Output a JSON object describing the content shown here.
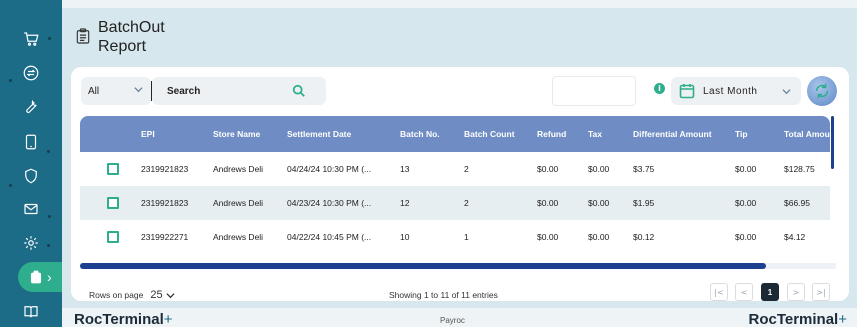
{
  "page": {
    "title_line1": "BatchOut",
    "title_line2": "Report"
  },
  "filters": {
    "scope_value": "All",
    "search_label": "Search",
    "date_range_value": "Last Month"
  },
  "table": {
    "columns": [
      "EPI",
      "Store Name",
      "Settlement Date",
      "Batch No.",
      "Batch Count",
      "Refund",
      "Tax",
      "Differential Amount",
      "Tip",
      "Total Amou"
    ],
    "rows": [
      [
        "2319921823",
        "Andrews Deli",
        "04/24/24 10:30 PM (...",
        "13",
        "2",
        "$0.00",
        "$0.00",
        "$3.75",
        "$0.00",
        "$128.75"
      ],
      [
        "2319921823",
        "Andrews Deli",
        "04/23/24 10:30 PM (...",
        "12",
        "2",
        "$0.00",
        "$0.00",
        "$1.95",
        "$0.00",
        "$66.95"
      ],
      [
        "2319922271",
        "Andrews Deli",
        "04/22/24 10:45 PM (...",
        "10",
        "1",
        "$0.00",
        "$0.00",
        "$0.12",
        "$0.00",
        "$4.12"
      ]
    ]
  },
  "pagination": {
    "rows_label": "Rows on page",
    "rows_value": "25",
    "showing_text": "Showing 1 to 11 of 11 entries",
    "first": "|<",
    "prev": "<",
    "current_page": "1",
    "next": ">",
    "last": ">|"
  },
  "footer": {
    "brand_main": "RocTerminal",
    "brand_plus": "+",
    "center_text": "Payroc"
  },
  "colors": {
    "sidebar": "#1c6b87",
    "accent": "#2fae8e",
    "table_header": "#6f8dc4",
    "scrollbar": "#1c3f8f"
  },
  "icons": {
    "sidebar": [
      "cart-icon",
      "exchange-icon",
      "wrench-icon",
      "tablet-icon",
      "shield-icon",
      "mail-icon",
      "settings-icon",
      "batch-report-icon",
      "book-icon"
    ],
    "title": "clipboard-icon",
    "search": "search-icon",
    "info": "info-icon",
    "calendar": "calendar-icon",
    "refresh": "refresh-icon"
  }
}
